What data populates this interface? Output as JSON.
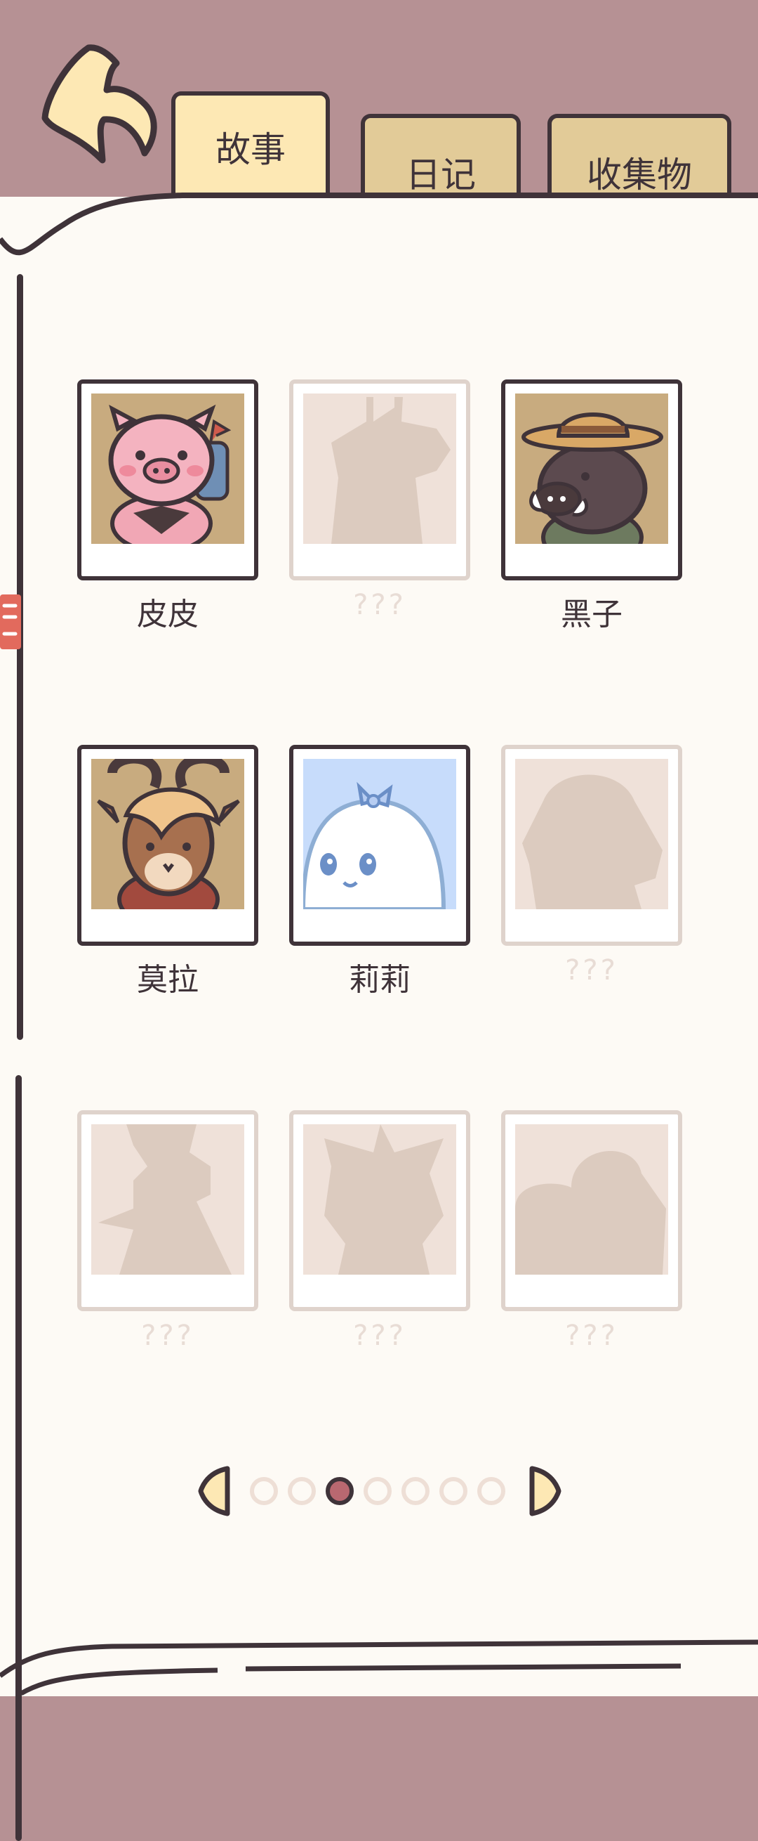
{
  "header": {
    "back_icon": "curved-back-arrow-icon",
    "tabs": [
      {
        "label": "故事",
        "active": true
      },
      {
        "label": "日记",
        "active": false
      },
      {
        "label": "收集物",
        "active": false
      }
    ]
  },
  "side_bookmark_icon": "red-bookmark-icon",
  "characters": [
    {
      "name": "皮皮",
      "unlocked": true,
      "portrait": "pink-pig-backpack-icon"
    },
    {
      "name": "???",
      "unlocked": false,
      "portrait": "giraffe-silhouette-icon"
    },
    {
      "name": "黑子",
      "unlocked": true,
      "portrait": "boar-straw-hat-icon"
    },
    {
      "name": "莫拉",
      "unlocked": true,
      "portrait": "antelope-horns-icon"
    },
    {
      "name": "莉莉",
      "unlocked": true,
      "portrait": "white-ghost-bow-icon"
    },
    {
      "name": "???",
      "unlocked": false,
      "portrait": "dog-silhouette-icon"
    },
    {
      "name": "???",
      "unlocked": false,
      "portrait": "figure-with-hat-silhouette-icon"
    },
    {
      "name": "???",
      "unlocked": false,
      "portrait": "bow-girl-silhouette-icon"
    },
    {
      "name": "???",
      "unlocked": false,
      "portrait": "round-creature-silhouette-icon"
    }
  ],
  "pagination": {
    "total_pages": 7,
    "current_page": 3
  },
  "colors": {
    "header_bg": "#b69194",
    "page_bg": "#fdfaf5",
    "outline": "#3f3339",
    "active_tab": "#fde8b4",
    "inactive_tab": "#e2cb98",
    "active_dot": "#b96870",
    "locked": "#dfd3cc"
  }
}
